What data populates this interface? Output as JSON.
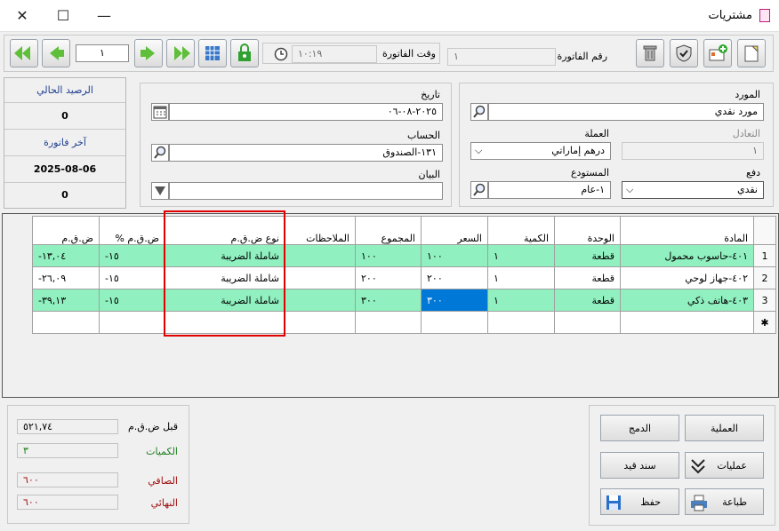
{
  "window": {
    "title": "مشتريات"
  },
  "toolbar": {
    "page_number": "١",
    "invoice_time_label": "وقت الفاتورة",
    "invoice_time": "١٠:١٩",
    "invoice_number_label": "رقم الفاتورة",
    "invoice_number": "١"
  },
  "side_info": {
    "balance_label": "الرصيد الحالي",
    "balance_value": "0",
    "last_invoice_label": "آخر فاتورة",
    "last_invoice_date": "2025-08-06",
    "last_invoice_value": "0"
  },
  "middle_form": {
    "date_label": "تاريخ",
    "date_value": "٢٠٢٥-٠٨-٠٦",
    "account_label": "الحساب",
    "account_value": "١٣١-الصندوق",
    "statement_label": "البيان",
    "statement_value": ""
  },
  "right_form": {
    "supplier_label": "المورد",
    "supplier_value": "مورد نقدي",
    "currency_label": "العملة",
    "currency_value": "درهم إماراتي",
    "rate_label": "التعادل",
    "rate_value": "١",
    "warehouse_label": "المستودع",
    "warehouse_value": "١-عام",
    "payment_label": "دفع",
    "payment_value": "نقدي"
  },
  "grid": {
    "headers": {
      "item": "المادة",
      "unit": "الوحدة",
      "qty": "الكمية",
      "price": "السعر",
      "total": "المجموع",
      "notes": "الملاحظات",
      "tax_type": "نوع ض.ق.م",
      "tax_pct": "ض.ق.م %",
      "tax": "ض.ق.م"
    },
    "rows": [
      {
        "no": "1",
        "item": "٤٠١-حاسوب محمول",
        "unit": "قطعة",
        "qty": "١",
        "price": "١٠٠",
        "total": "١٠٠",
        "notes": "",
        "tax_type": "شاملة الضريبة",
        "tax_pct": "١٥-",
        "tax": "١٣,٠٤-"
      },
      {
        "no": "2",
        "item": "٤٠٢-جهاز لوحي",
        "unit": "قطعة",
        "qty": "١",
        "price": "٢٠٠",
        "total": "٢٠٠",
        "notes": "",
        "tax_type": "شاملة الضريبة",
        "tax_pct": "١٥-",
        "tax": "٢٦,٠٩-"
      },
      {
        "no": "3",
        "item": "٤٠٣-هاتف ذكي",
        "unit": "قطعة",
        "qty": "١",
        "price": "٣٠٠",
        "total": "٣٠٠",
        "notes": "",
        "tax_type": "شاملة الضريبة",
        "tax_pct": "١٥-",
        "tax": "٣٩,١٣-"
      }
    ]
  },
  "summary": {
    "before_tax_label": "قبل ض.ق.م",
    "before_tax_value": "٥٢١,٧٤",
    "quantities_label": "الكميات",
    "quantities_value": "٣",
    "net_label": "الصافي",
    "net_value": "٦٠٠",
    "final_label": "النهائي",
    "final_value": "٦٠٠"
  },
  "actions": {
    "operation": "العملية",
    "merge": "الدمج",
    "operations": "عمليات",
    "journal": "سند قيد",
    "print": "طباعة",
    "save": "حفظ"
  },
  "colors": {
    "row_highlight": "#90f0c0",
    "selected_cell": "#0078d7",
    "highlight_border": "#e00000",
    "label_blue": "#1f3f8f"
  }
}
